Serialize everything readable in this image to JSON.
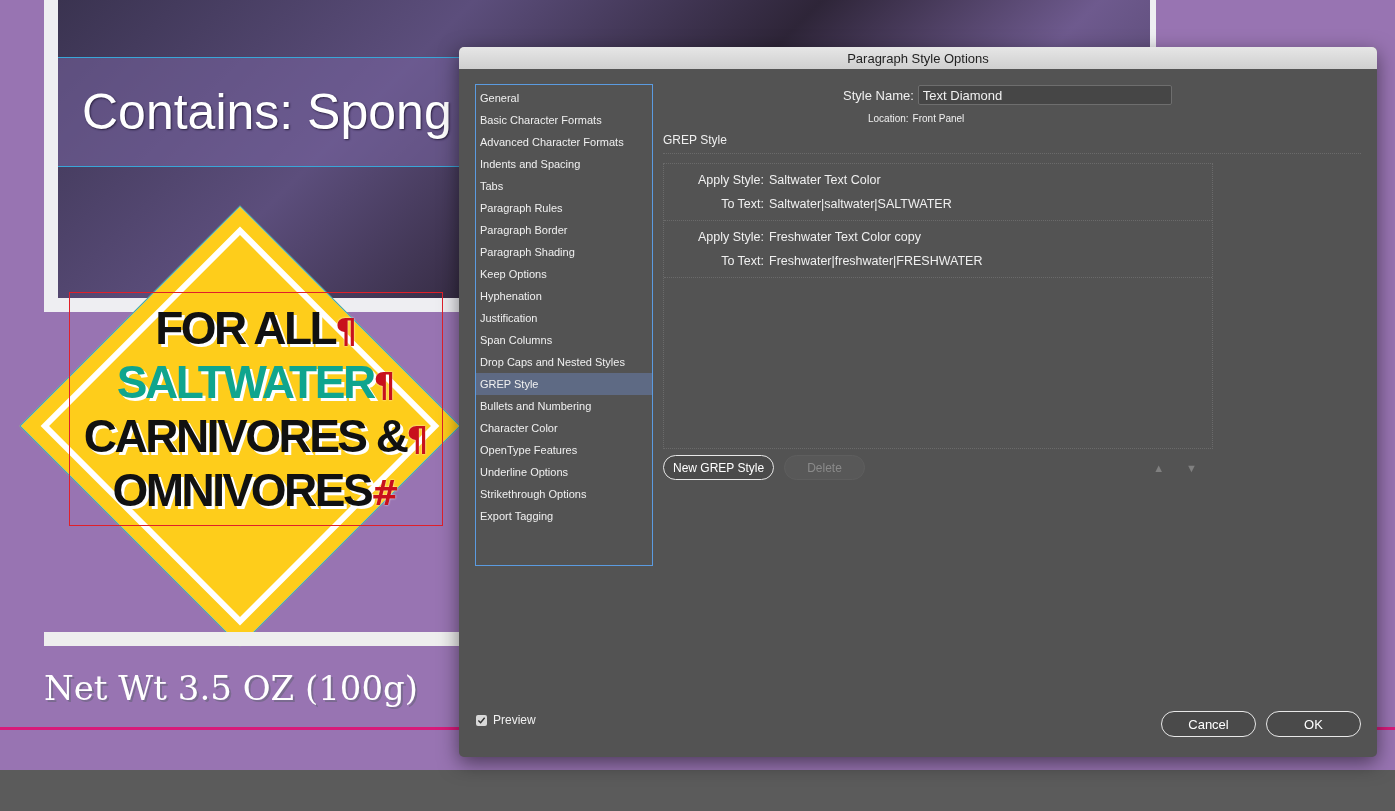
{
  "canvas": {
    "headline": "Contains: Spong",
    "diamond_lines": [
      {
        "text": "FOR ALL",
        "kind": "plain",
        "mark": "¶"
      },
      {
        "text": "SALTWATER",
        "kind": "highlight",
        "mark": "¶"
      },
      {
        "text": "CARNIVORES &",
        "kind": "plain",
        "mark": "¶"
      },
      {
        "text": "OMNIVORES",
        "kind": "plain",
        "mark": "#"
      }
    ],
    "net_weight": "Net Wt 3.5 OZ (100g)"
  },
  "dialog": {
    "title": "Paragraph Style Options",
    "categories": [
      {
        "label": "General",
        "selected": false
      },
      {
        "label": "Basic Character Formats",
        "selected": false
      },
      {
        "label": "Advanced Character Formats",
        "selected": false
      },
      {
        "label": "Indents and Spacing",
        "selected": false
      },
      {
        "label": "Tabs",
        "selected": false
      },
      {
        "label": "Paragraph Rules",
        "selected": false
      },
      {
        "label": "Paragraph Border",
        "selected": false
      },
      {
        "label": "Paragraph Shading",
        "selected": false
      },
      {
        "label": "Keep Options",
        "selected": false
      },
      {
        "label": "Hyphenation",
        "selected": false
      },
      {
        "label": "Justification",
        "selected": false
      },
      {
        "label": "Span Columns",
        "selected": false
      },
      {
        "label": "Drop Caps and Nested Styles",
        "selected": false
      },
      {
        "label": "GREP Style",
        "selected": true
      },
      {
        "label": "Bullets and Numbering",
        "selected": false
      },
      {
        "label": "Character Color",
        "selected": false
      },
      {
        "label": "OpenType Features",
        "selected": false
      },
      {
        "label": "Underline Options",
        "selected": false
      },
      {
        "label": "Strikethrough Options",
        "selected": false
      },
      {
        "label": "Export Tagging",
        "selected": false
      }
    ],
    "style_name_label": "Style Name:",
    "style_name": "Text Diamond",
    "location_label": "Location:",
    "location": "Front Panel",
    "section_title": "GREP Style",
    "grep_styles": [
      {
        "apply_label": "Apply Style:",
        "style": "Saltwater Text Color",
        "to_label": "To Text:",
        "pattern": "Saltwater|saltwater|SALTWATER"
      },
      {
        "apply_label": "Apply Style:",
        "style": "Freshwater Text Color copy",
        "to_label": "To Text:",
        "pattern": "Freshwater|freshwater|FRESHWATER"
      }
    ],
    "new_button": "New GREP Style",
    "delete_button": {
      "label": "Delete",
      "disabled": true
    },
    "move_buttons": [
      {
        "label": "▲",
        "disabled": true
      },
      {
        "label": "▼",
        "disabled": true
      }
    ],
    "preview": {
      "label": "Preview",
      "checked": true
    },
    "buttons": [
      "Cancel",
      "OK"
    ]
  }
}
